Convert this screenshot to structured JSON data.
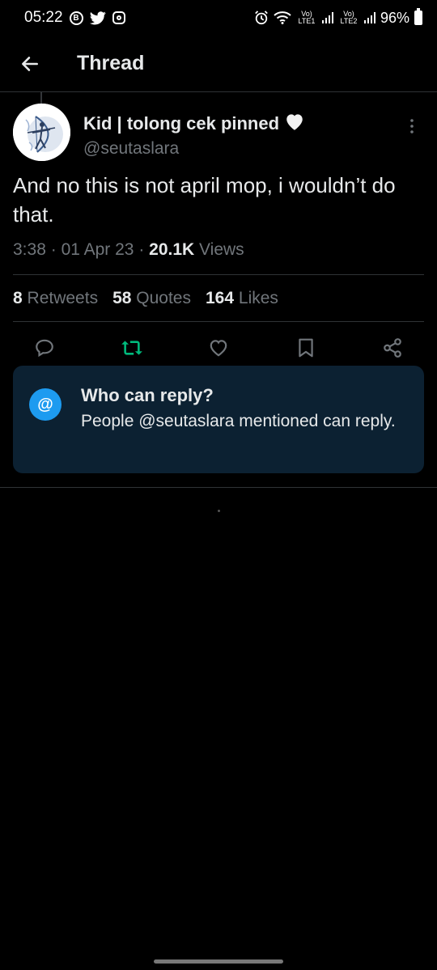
{
  "status_bar": {
    "time": "05:22",
    "notif_b": "B",
    "lte1": "Vo) LTE1",
    "lte2": "Vo) LTE2",
    "battery": "96%"
  },
  "header": {
    "title": "Thread",
    "back_icon": "arrow-left-icon"
  },
  "tweet": {
    "display_name": "Kid | tolong cek pinned",
    "name_emoji": "🤍",
    "handle": "@seutaslara",
    "text": "And no this is not april mop, i wouldn’t do that.",
    "time": "3:38",
    "date": "01 Apr 23",
    "views_count": "20.1K",
    "views_label": "Views",
    "sep": "·"
  },
  "stats": {
    "retweets_count": "8",
    "retweets_label": "Retweets",
    "quotes_count": "58",
    "quotes_label": "Quotes",
    "likes_count": "164",
    "likes_label": "Likes"
  },
  "actions": [
    "reply-icon",
    "retweet-icon",
    "like-icon",
    "bookmark-icon",
    "share-icon"
  ],
  "reply_settings": {
    "icon_glyph": "@",
    "title": "Who can reply?",
    "body": "People @seutaslara mentioned can reply."
  },
  "colors": {
    "background": "#000000",
    "text": "#e7e9ea",
    "muted": "#71767b",
    "accent": "#1d9bf0",
    "retweet_green": "#00ba7c",
    "card": "#0c2132"
  }
}
